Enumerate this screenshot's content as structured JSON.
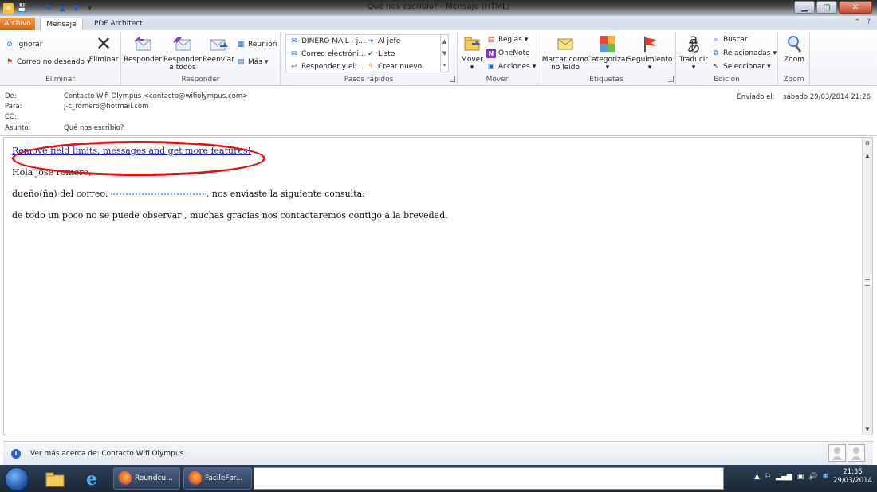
{
  "window": {
    "title": "Qué nos escribio? - Mensaje (HTML)"
  },
  "tabs": [
    {
      "label": "Archivo"
    },
    {
      "label": "Mensaje"
    },
    {
      "label": "PDF Architect"
    }
  ],
  "ribbon": {
    "eliminar": {
      "label": "Eliminar",
      "ignorar": "Ignorar",
      "correo_no_deseado": "Correo no deseado",
      "eliminar_btn": "Eliminar"
    },
    "responder": {
      "label": "Responder",
      "responder": "Responder",
      "responder_todos": "Responder a todos",
      "reenviar": "Reenviar",
      "reunion": "Reunión",
      "mas": "Más"
    },
    "pasos_rapidos": {
      "label": "Pasos rápidos",
      "items": [
        "DINERO MAIL - j...",
        "Correo electróni...",
        "Responder y eli...",
        "Al jefe",
        "Listo",
        "Crear nuevo"
      ]
    },
    "mover": {
      "label": "Mover",
      "mover_btn": "Mover",
      "reglas": "Reglas",
      "onenote": "OneNote",
      "acciones": "Acciones"
    },
    "etiquetas": {
      "label": "Etiquetas",
      "marcar": "Marcar como no leído",
      "categorizar": "Categorizar",
      "seguimiento": "Seguimiento"
    },
    "edicion": {
      "label": "Edición",
      "traducir": "Traducir",
      "buscar": "Buscar",
      "relacionadas": "Relacionadas",
      "seleccionar": "Seleccionar"
    },
    "zoom": {
      "label": "Zoom",
      "zoom_btn": "Zoom"
    }
  },
  "header": {
    "de_label": "De:",
    "de_value": "Contacto Wifi Olympus <contacto@wifiolympus.com>",
    "para_label": "Para:",
    "para_value": "j-c_romero@hotmail.com",
    "cc_label": "CC:",
    "cc_value": "",
    "asunto_label": "Asunto:",
    "asunto_value": "Qué nos escribio?",
    "enviado_label": "Enviado el:",
    "enviado_value": "sábado 29/03/2014 21:26"
  },
  "body": {
    "promo_link": "Remove field limits, messages and get more features!",
    "greeting": "Hola jose romero,",
    "line1_prefix": "dueño(ña) del correo.",
    "line1_suffix": ", nos enviaste la siguiente consulta:",
    "line2": "de todo un poco no se puede observar , muchas gracias nos contactaremos contigo a la brevedad."
  },
  "people_pane": {
    "text": "Ver más acerca de: Contacto Wifi Olympus."
  },
  "taskbar": {
    "apps": [
      {
        "label": "Roundcu..."
      },
      {
        "label": "FacileFor..."
      }
    ],
    "clock_time": "21:35",
    "clock_date": "29/03/2014"
  },
  "colors": {
    "archivo_tab": "#e0731f",
    "link": "#1a1ac8",
    "annotation": "#e21212",
    "taskbar": "#1c2636"
  }
}
